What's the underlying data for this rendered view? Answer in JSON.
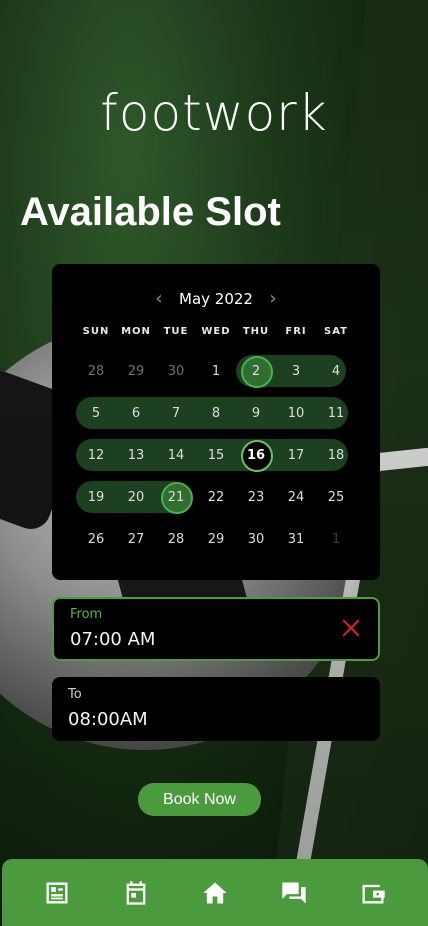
{
  "app": {
    "logo": "footwork"
  },
  "page": {
    "title": "Available Slot"
  },
  "calendar": {
    "month_label": "May 2022",
    "weekdays": [
      "SUN",
      "MON",
      "TUE",
      "WED",
      "THU",
      "FRI",
      "SAT"
    ],
    "weeks": [
      [
        "28",
        "29",
        "30",
        "1",
        "2",
        "3",
        "4"
      ],
      [
        "5",
        "6",
        "7",
        "8",
        "9",
        "10",
        "11"
      ],
      [
        "12",
        "13",
        "14",
        "15",
        "16",
        "17",
        "18"
      ],
      [
        "19",
        "20",
        "21",
        "22",
        "23",
        "24",
        "25"
      ],
      [
        "26",
        "27",
        "28",
        "29",
        "30",
        "31",
        "1"
      ]
    ],
    "range_start": "2",
    "range_end": "21",
    "today": "16"
  },
  "time": {
    "from_label": "From",
    "from_value": "07:00 AM",
    "to_label": "To",
    "to_value": "08:00AM"
  },
  "actions": {
    "book_label": "Book Now"
  },
  "nav": {
    "items": [
      {
        "name": "profile-card-icon"
      },
      {
        "name": "calendar-icon"
      },
      {
        "name": "home-icon"
      },
      {
        "name": "chat-icon"
      },
      {
        "name": "wallet-icon"
      }
    ]
  },
  "colors": {
    "accent": "#4c9a3e",
    "range_bg": "#1d4020",
    "clear": "#e02020"
  }
}
